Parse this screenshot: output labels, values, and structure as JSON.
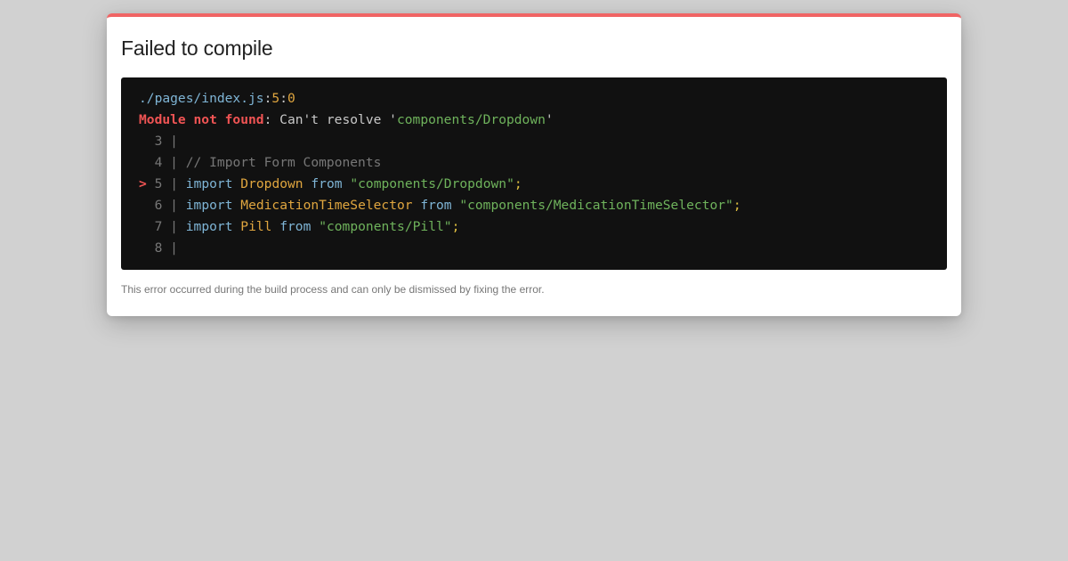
{
  "dialog": {
    "title": "Failed to compile",
    "footer": "This error occurred during the build process and can only be dismissed by fixing the error."
  },
  "error": {
    "file": "./pages/index.js",
    "sep1": ":",
    "line": "5",
    "sep2": ":",
    "column": "0",
    "type": "Module not found",
    "message_prefix": ": Can't resolve '",
    "module": "components/Dropdown",
    "message_suffix": "'"
  },
  "code_frame": {
    "marker": ">",
    "pipe": "|",
    "lines": [
      {
        "num": "3"
      },
      {
        "num": "4",
        "comment": "// Import Form Components"
      },
      {
        "num": "5",
        "keyword": "import",
        "name": "Dropdown",
        "from": "from",
        "source": "\"components/Dropdown\"",
        "semi": ";"
      },
      {
        "num": "6",
        "keyword": "import",
        "name": "MedicationTimeSelector",
        "from": "from",
        "source": "\"components/MedicationTimeSelector\"",
        "semi": ";"
      },
      {
        "num": "7",
        "keyword": "import",
        "name": "Pill",
        "from": "from",
        "source": "\"components/Pill\"",
        "semi": ";"
      },
      {
        "num": "8"
      }
    ]
  },
  "colors": {
    "accent": "#f06464",
    "code_background": "#111111",
    "string": "#6fb35c",
    "identifier": "#e0a63f",
    "keyword": "#7fb5d6"
  }
}
